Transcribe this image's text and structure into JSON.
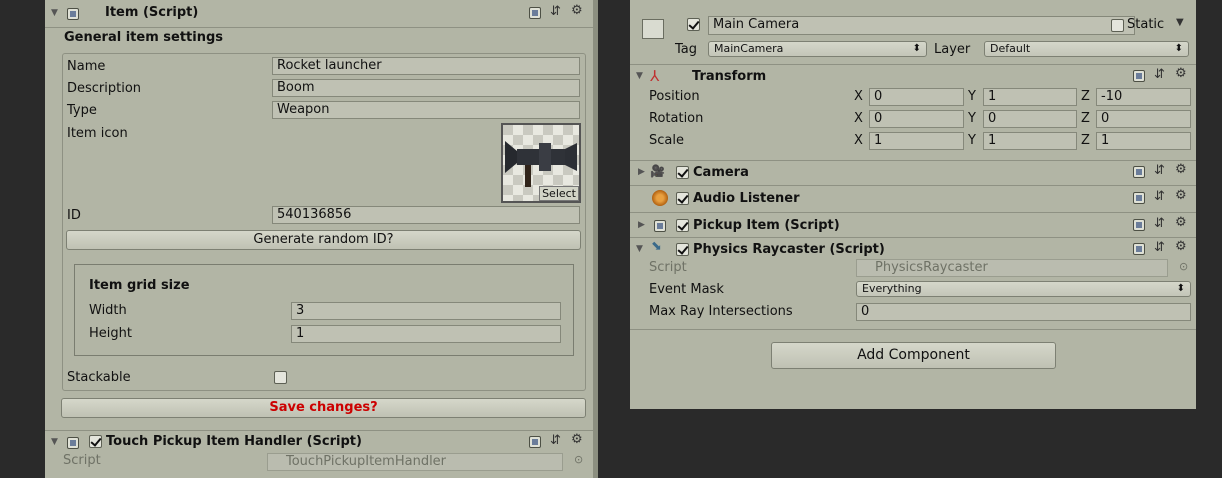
{
  "left": {
    "item_header": {
      "title": "Item (Script)"
    },
    "general_title": "General item settings",
    "fields": {
      "name_label": "Name",
      "name_value": "Rocket launcher",
      "desc_label": "Description",
      "desc_value": "Boom",
      "type_label": "Type",
      "type_value": "Weapon",
      "icon_label": "Item icon",
      "icon_select": "Select",
      "id_label": "ID",
      "id_value": "540136856"
    },
    "generate_button": "Generate random ID?",
    "grid": {
      "title": "Item grid size",
      "width_label": "Width",
      "width_value": "3",
      "height_label": "Height",
      "height_value": "1"
    },
    "stackable_label": "Stackable",
    "save_button": "Save changes?",
    "touch_header": {
      "title": "Touch Pickup Item Handler (Script)"
    },
    "touch_script": {
      "label": "Script",
      "value": "TouchPickupItemHandler"
    }
  },
  "right": {
    "object": {
      "name": "Main Camera",
      "static_label": "Static",
      "tag_label": "Tag",
      "tag_value": "MainCamera",
      "layer_label": "Layer",
      "layer_value": "Default"
    },
    "transform": {
      "title": "Transform",
      "rows": [
        {
          "label": "Position",
          "x": "0",
          "y": "1",
          "z": "-10"
        },
        {
          "label": "Rotation",
          "x": "0",
          "y": "0",
          "z": "0"
        },
        {
          "label": "Scale",
          "x": "1",
          "y": "1",
          "z": "1"
        }
      ],
      "axis": {
        "x": "X",
        "y": "Y",
        "z": "Z"
      }
    },
    "components": {
      "camera": "Camera",
      "audio": "Audio Listener",
      "pickup": "Pickup Item (Script)",
      "raycaster": "Physics Raycaster (Script)"
    },
    "raycaster": {
      "script_label": "Script",
      "script_value": "PhysicsRaycaster",
      "mask_label": "Event Mask",
      "mask_value": "Everything",
      "max_label": "Max Ray Intersections",
      "max_value": "0"
    },
    "add_component": "Add Component"
  },
  "colors": {
    "panel": "#b2b5a5",
    "field": "#bfc1b3",
    "save_text": "#cc0000",
    "background": "#2a2a2a"
  }
}
